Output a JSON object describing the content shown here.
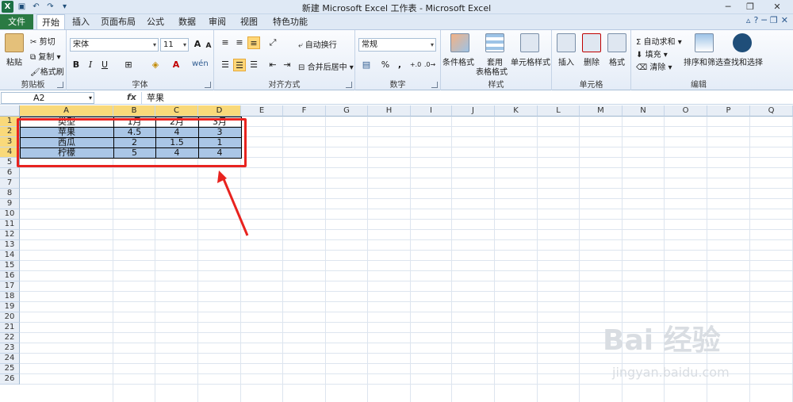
{
  "window": {
    "title": "新建 Microsoft Excel 工作表 - Microsoft Excel",
    "logo_text": "X",
    "buttons": [
      "─",
      "❐",
      "✕"
    ]
  },
  "tabs": [
    {
      "label": "文件",
      "active": false
    },
    {
      "label": "开始",
      "active": true
    },
    {
      "label": "插入",
      "active": false
    },
    {
      "label": "页面布局",
      "active": false
    },
    {
      "label": "公式",
      "active": false
    },
    {
      "label": "数据",
      "active": false
    },
    {
      "label": "审阅",
      "active": false
    },
    {
      "label": "视图",
      "active": false
    },
    {
      "label": "特色功能",
      "active": false
    }
  ],
  "ribbon": {
    "clipboard": {
      "title": "剪贴板",
      "paste": "粘贴",
      "cut": "剪切",
      "copy": "复制 ▾",
      "format_painter": "格式刷"
    },
    "font": {
      "title": "字体",
      "font_name": "宋体",
      "font_size": "11",
      "bold": "B",
      "italic": "I",
      "underline": "U",
      "grow": "A",
      "shrink": "A",
      "phonetic": "wén"
    },
    "alignment": {
      "title": "对齐方式",
      "wrap": "自动换行",
      "merge": "合并后居中 ▾"
    },
    "number": {
      "title": "数字",
      "format": "常规",
      "percent": "%",
      "comma": ","
    },
    "styles": {
      "title": "样式",
      "conditional": "条件格式",
      "table": "套用",
      "table2": "表格格式",
      "cell_styles": "单元格样式"
    },
    "cells": {
      "title": "单元格",
      "insert": "插入",
      "delete": "删除",
      "format": "格式"
    },
    "editing": {
      "title": "编辑",
      "autosum": "自动求和 ▾",
      "fill": "填充 ▾",
      "clear": "清除 ▾",
      "sort": "排序和筛选",
      "find": "查找和选择"
    }
  },
  "formula_bar": {
    "name_box": "A2",
    "fx": "fx",
    "value": "苹果"
  },
  "columns": [
    "A",
    "B",
    "C",
    "D",
    "E",
    "F",
    "G",
    "H",
    "I",
    "J",
    "K",
    "L",
    "M",
    "N",
    "O",
    "P",
    "Q"
  ],
  "rows": [
    "1",
    "2",
    "3",
    "4",
    "5",
    "6",
    "7",
    "8",
    "9",
    "10",
    "11",
    "12",
    "13",
    "14",
    "15",
    "16",
    "17",
    "18",
    "19",
    "20",
    "21",
    "22",
    "23",
    "24",
    "25",
    "26"
  ],
  "table": {
    "header": [
      "类型",
      "1月",
      "2月",
      "3月"
    ],
    "data": [
      [
        "苹果",
        "4.5",
        "4",
        "3"
      ],
      [
        "西瓜",
        "2",
        "1.5",
        "1"
      ],
      [
        "柠檬",
        "5",
        "4",
        "4"
      ]
    ]
  },
  "watermark": {
    "brand": "Bai 经验",
    "url": "jingyan.baidu.com"
  },
  "colors": {
    "selection_fill": "#aac6e6",
    "annotation_red": "#e8231f",
    "header_highlight": "#f9d97a",
    "file_tab": "#2a7a43"
  }
}
